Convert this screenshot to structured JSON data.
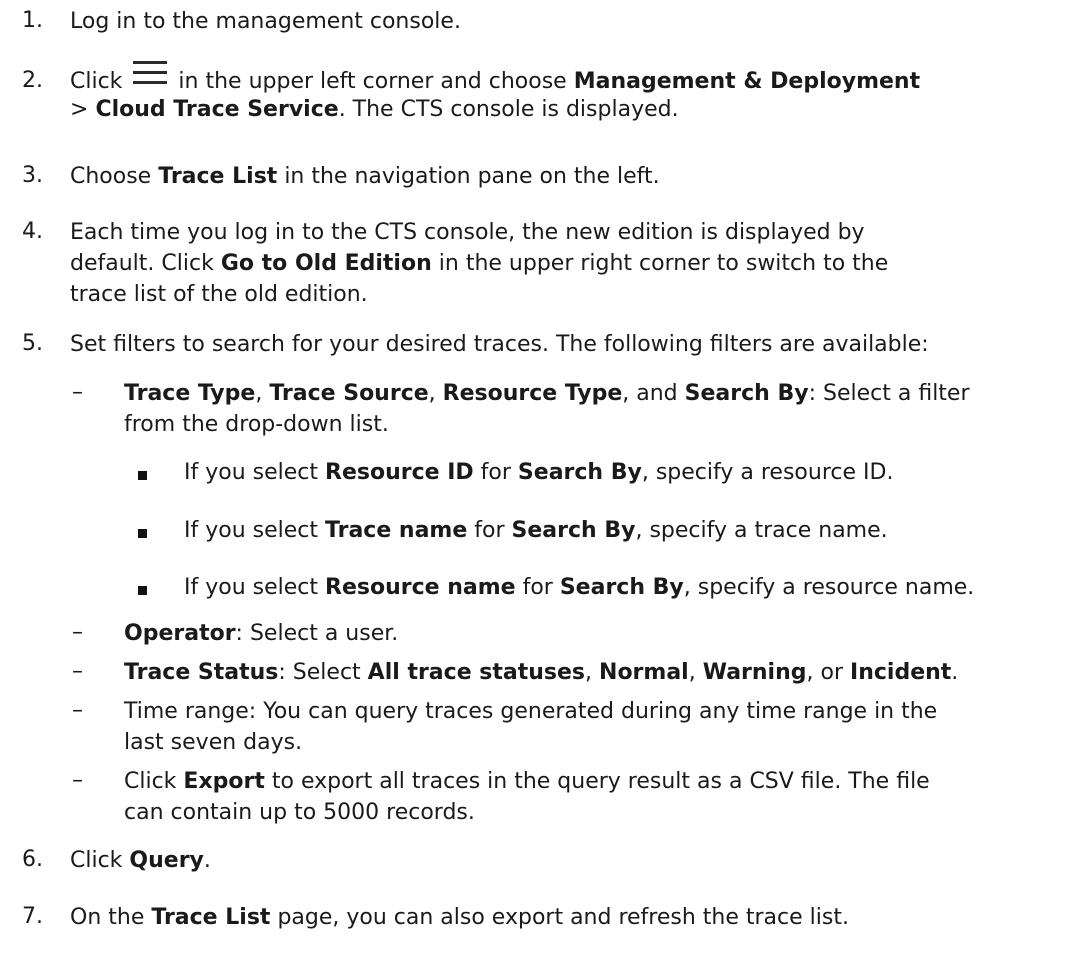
{
  "steps": [
    {
      "num": "1.",
      "t": [
        "Log in to the management console."
      ]
    },
    {
      "num": "2.",
      "t": [
        "Click",
        "in the upper left corner and choose",
        "Management & Deployment",
        ">",
        "Cloud Trace Service",
        ". The CTS console is displayed."
      ]
    },
    {
      "num": "3.",
      "t": [
        "Choose",
        "Trace List",
        "in the navigation pane on the left."
      ]
    },
    {
      "num": "4.",
      "t": [
        "Each time you log in to the CTS console, the new edition is displayed by",
        "default. Click",
        "Go to Old Edition",
        "in the upper right corner to switch to the",
        "trace list of the old edition."
      ]
    },
    {
      "num": "5.",
      "t": [
        "Set filters to search for your desired traces. The following filters are available:"
      ]
    },
    {
      "num": "6.",
      "t": [
        "Click",
        "Query",
        "."
      ]
    },
    {
      "num": "7.",
      "t": [
        "On the",
        "Trace List",
        "page, you can also export and refresh the trace list."
      ]
    }
  ],
  "filters": [
    {
      "t": [
        "Trace Type",
        ",",
        "Trace Source",
        ",",
        "Resource Type",
        ", and",
        "Search By",
        ": Select a filter",
        "from the drop-down list."
      ]
    },
    {
      "t": [
        "Operator",
        ": Select a user."
      ]
    },
    {
      "t": [
        "Trace Status",
        ": Select",
        "All trace statuses",
        ",",
        "Normal",
        ",",
        "Warning",
        ", or",
        "Incident",
        "."
      ]
    },
    {
      "t": [
        "Time range: You can query traces generated during any time range in the",
        "last seven days."
      ]
    },
    {
      "t": [
        "Click",
        "Export",
        "to export all traces in the query result as a CSV file. The file",
        "can contain up to 5000 records."
      ]
    }
  ],
  "dash": "–",
  "search_by": [
    {
      "t": [
        "If you select",
        "Resource ID",
        "for",
        "Search By",
        ", specify a resource ID."
      ]
    },
    {
      "t": [
        "If you select",
        "Trace name",
        "for",
        "Search By",
        ", specify a trace name."
      ]
    },
    {
      "t": [
        "If you select",
        "Resource name",
        "for",
        "Search By",
        ", specify a resource name."
      ]
    }
  ],
  "icons": {
    "menu": "hamburger-menu-icon"
  }
}
